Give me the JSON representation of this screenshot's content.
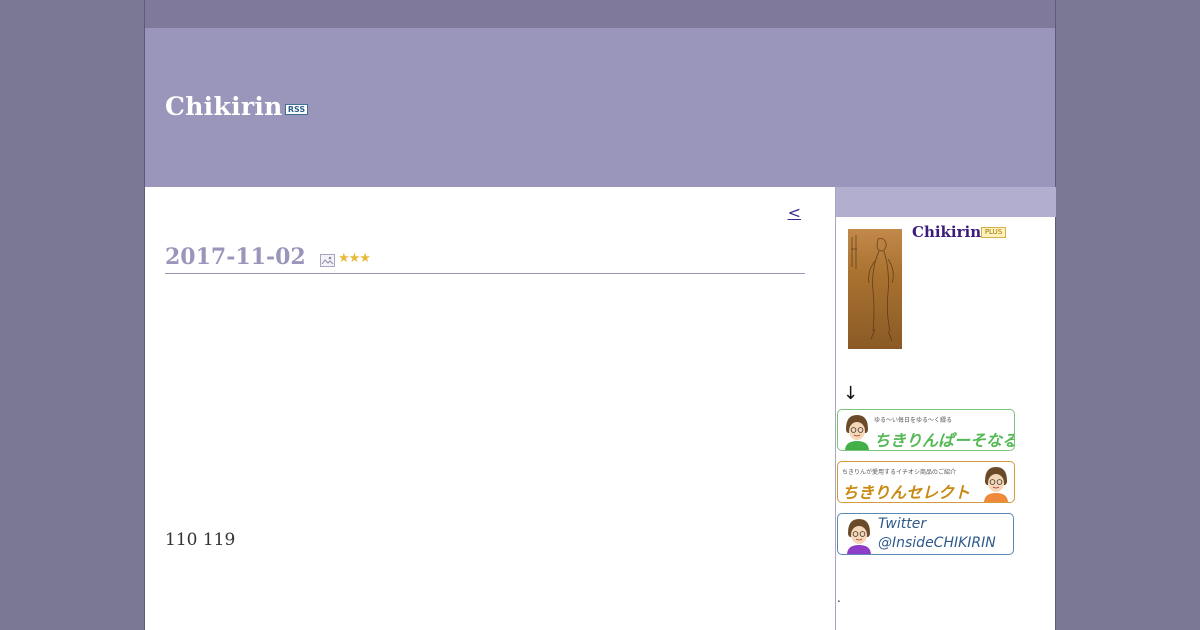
{
  "header": {
    "title": "Chikirin",
    "rss_label": "RSS"
  },
  "nav": {
    "prev_label": "<"
  },
  "entry": {
    "date": "2017-11-02",
    "category_icon": "image-icon",
    "stars": "★★★",
    "text": "110 119"
  },
  "sidebar": {
    "profile_name": "Chikirin",
    "plus_badge": "PLUS",
    "arrow": "↓",
    "banners": [
      {
        "small": "ゆる～い毎日をゆる～く綴る",
        "big": "ちきりんぱーそなる"
      },
      {
        "small": "ちきりんが愛用するイチオシ商品のご紹介",
        "big": "ちきりんセレクト"
      },
      {
        "line1": "Twitter",
        "line2": "@InsideCHIKIRIN"
      }
    ],
    "footer_dot": "."
  },
  "colors": {
    "background": "#7b7895",
    "topbar": "#7f7a9c",
    "header": "#9995bb",
    "sidebar_head": "#b1aed0",
    "date": "#9995bb",
    "link": "#3a2c8c"
  }
}
